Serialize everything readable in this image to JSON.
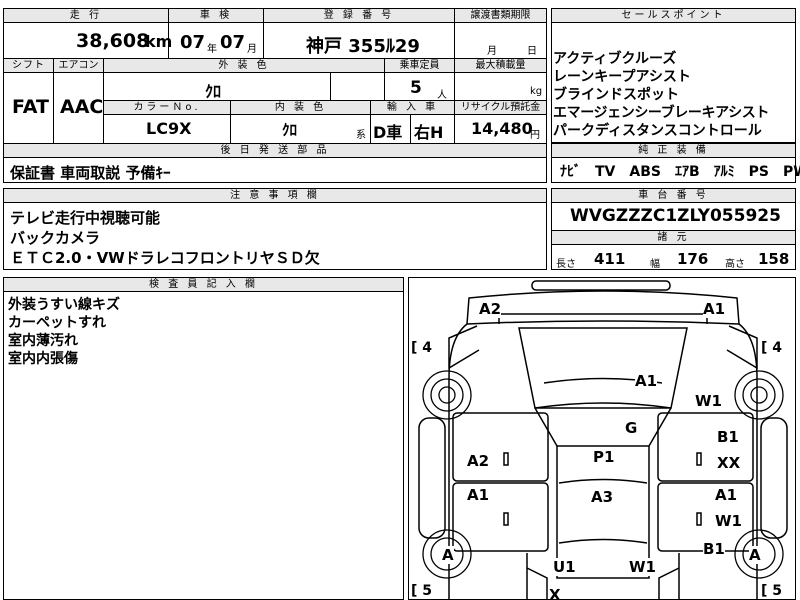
{
  "top": {
    "odometer_header": "走 行",
    "odometer_value": "38,608",
    "odometer_unit": "km",
    "inspection_header": "車 検",
    "inspection_year": "07",
    "inspection_year_unit": "年",
    "inspection_month": "07",
    "inspection_month_unit": "月",
    "registration_header": "登 録 番 号",
    "registration_value": "神戸 355ﾙ29",
    "transfer_header": "譲渡書類期限",
    "transfer_month_unit": "月",
    "transfer_day_unit": "日"
  },
  "row2": {
    "shift_header": "シフト",
    "aircon_header": "エアコン",
    "exterior_color_header": "外 装 色",
    "capacity_header": "乗車定員",
    "max_load_header": "最大積載量",
    "shift_value": "FAT",
    "aircon_value": "AAC",
    "exterior_color_value": "ｸﾛ",
    "capacity_value": "5",
    "capacity_unit": "人",
    "max_load_unit": "kg",
    "color_no_header": "カラーＮo.",
    "interior_color_header": "内 装 色",
    "import_header": "輸 入 車",
    "recycle_header": "リサイクル預託金",
    "color_no_value": "LC9X",
    "interior_color_value": "ｸﾛ",
    "interior_color_suffix": "系",
    "import_value_1": "D車",
    "import_value_2": "右H",
    "recycle_value": "14,480",
    "recycle_unit": "円"
  },
  "later_parts": {
    "header": "後 日 発 送 部 品",
    "value": "保証書 車両取説 予備ｷｰ"
  },
  "notes": {
    "header": "注 意 事 項 欄",
    "lines": [
      "テレビ走行中視聴可能",
      "バックカメラ",
      "ＥＴＣ2.0・VWドラレコフロントリヤＳＤ欠"
    ]
  },
  "inspector": {
    "header": "検 査 員 記 入 欄",
    "lines": [
      "外装うすい線キズ",
      "カーペットすれ",
      "室内薄汚れ",
      "室内内張傷"
    ]
  },
  "sales": {
    "header": "セールスポイント",
    "lines": [
      "アクティブクルーズ",
      "レーンキープアシスト",
      "ブラインドスポット",
      "エマージェンシーブレーキアシスト",
      "パークディスタンスコントロール"
    ]
  },
  "equipment": {
    "header": "純 正 装 備",
    "value": "ﾅﾋﾞ　TV　ABS　ｴｱB　ｱﾙﾐ　PS　PW"
  },
  "chassis": {
    "header": "車 台 番 号",
    "value": "WVGZZZC1ZLY055925"
  },
  "dimensions": {
    "header": "諸 元",
    "length_label": "長さ",
    "length_value": "411",
    "width_label": "幅",
    "width_value": "176",
    "height_label": "高さ",
    "height_value": "158"
  },
  "diagram": {
    "tire_left_top": "[ 4",
    "tire_right_top": "[ 4",
    "tire_left_bottom": "[ 5",
    "tire_right_bottom": "[ 5",
    "marks": {
      "a2_front_left": "A2",
      "a1_front_right": "A1",
      "a1_hood": "A1",
      "w1_windshield": "W1",
      "g_roof": "G",
      "a2_left_door_front": "A2",
      "b1_right_door_front": "B1",
      "xx_right_door_front": "XX",
      "p1_roof": "P1",
      "a1_left_door_rear": "A1",
      "a3_roof": "A3",
      "a1_right_door_rear": "A1",
      "w1_right_rear": "W1",
      "a_left_rear_wheel": "A",
      "b1_right_rear": "B1",
      "a_right_rear_wheel": "A",
      "u1_rear": "U1",
      "w1_rear": "W1",
      "x_rear": "X"
    }
  }
}
